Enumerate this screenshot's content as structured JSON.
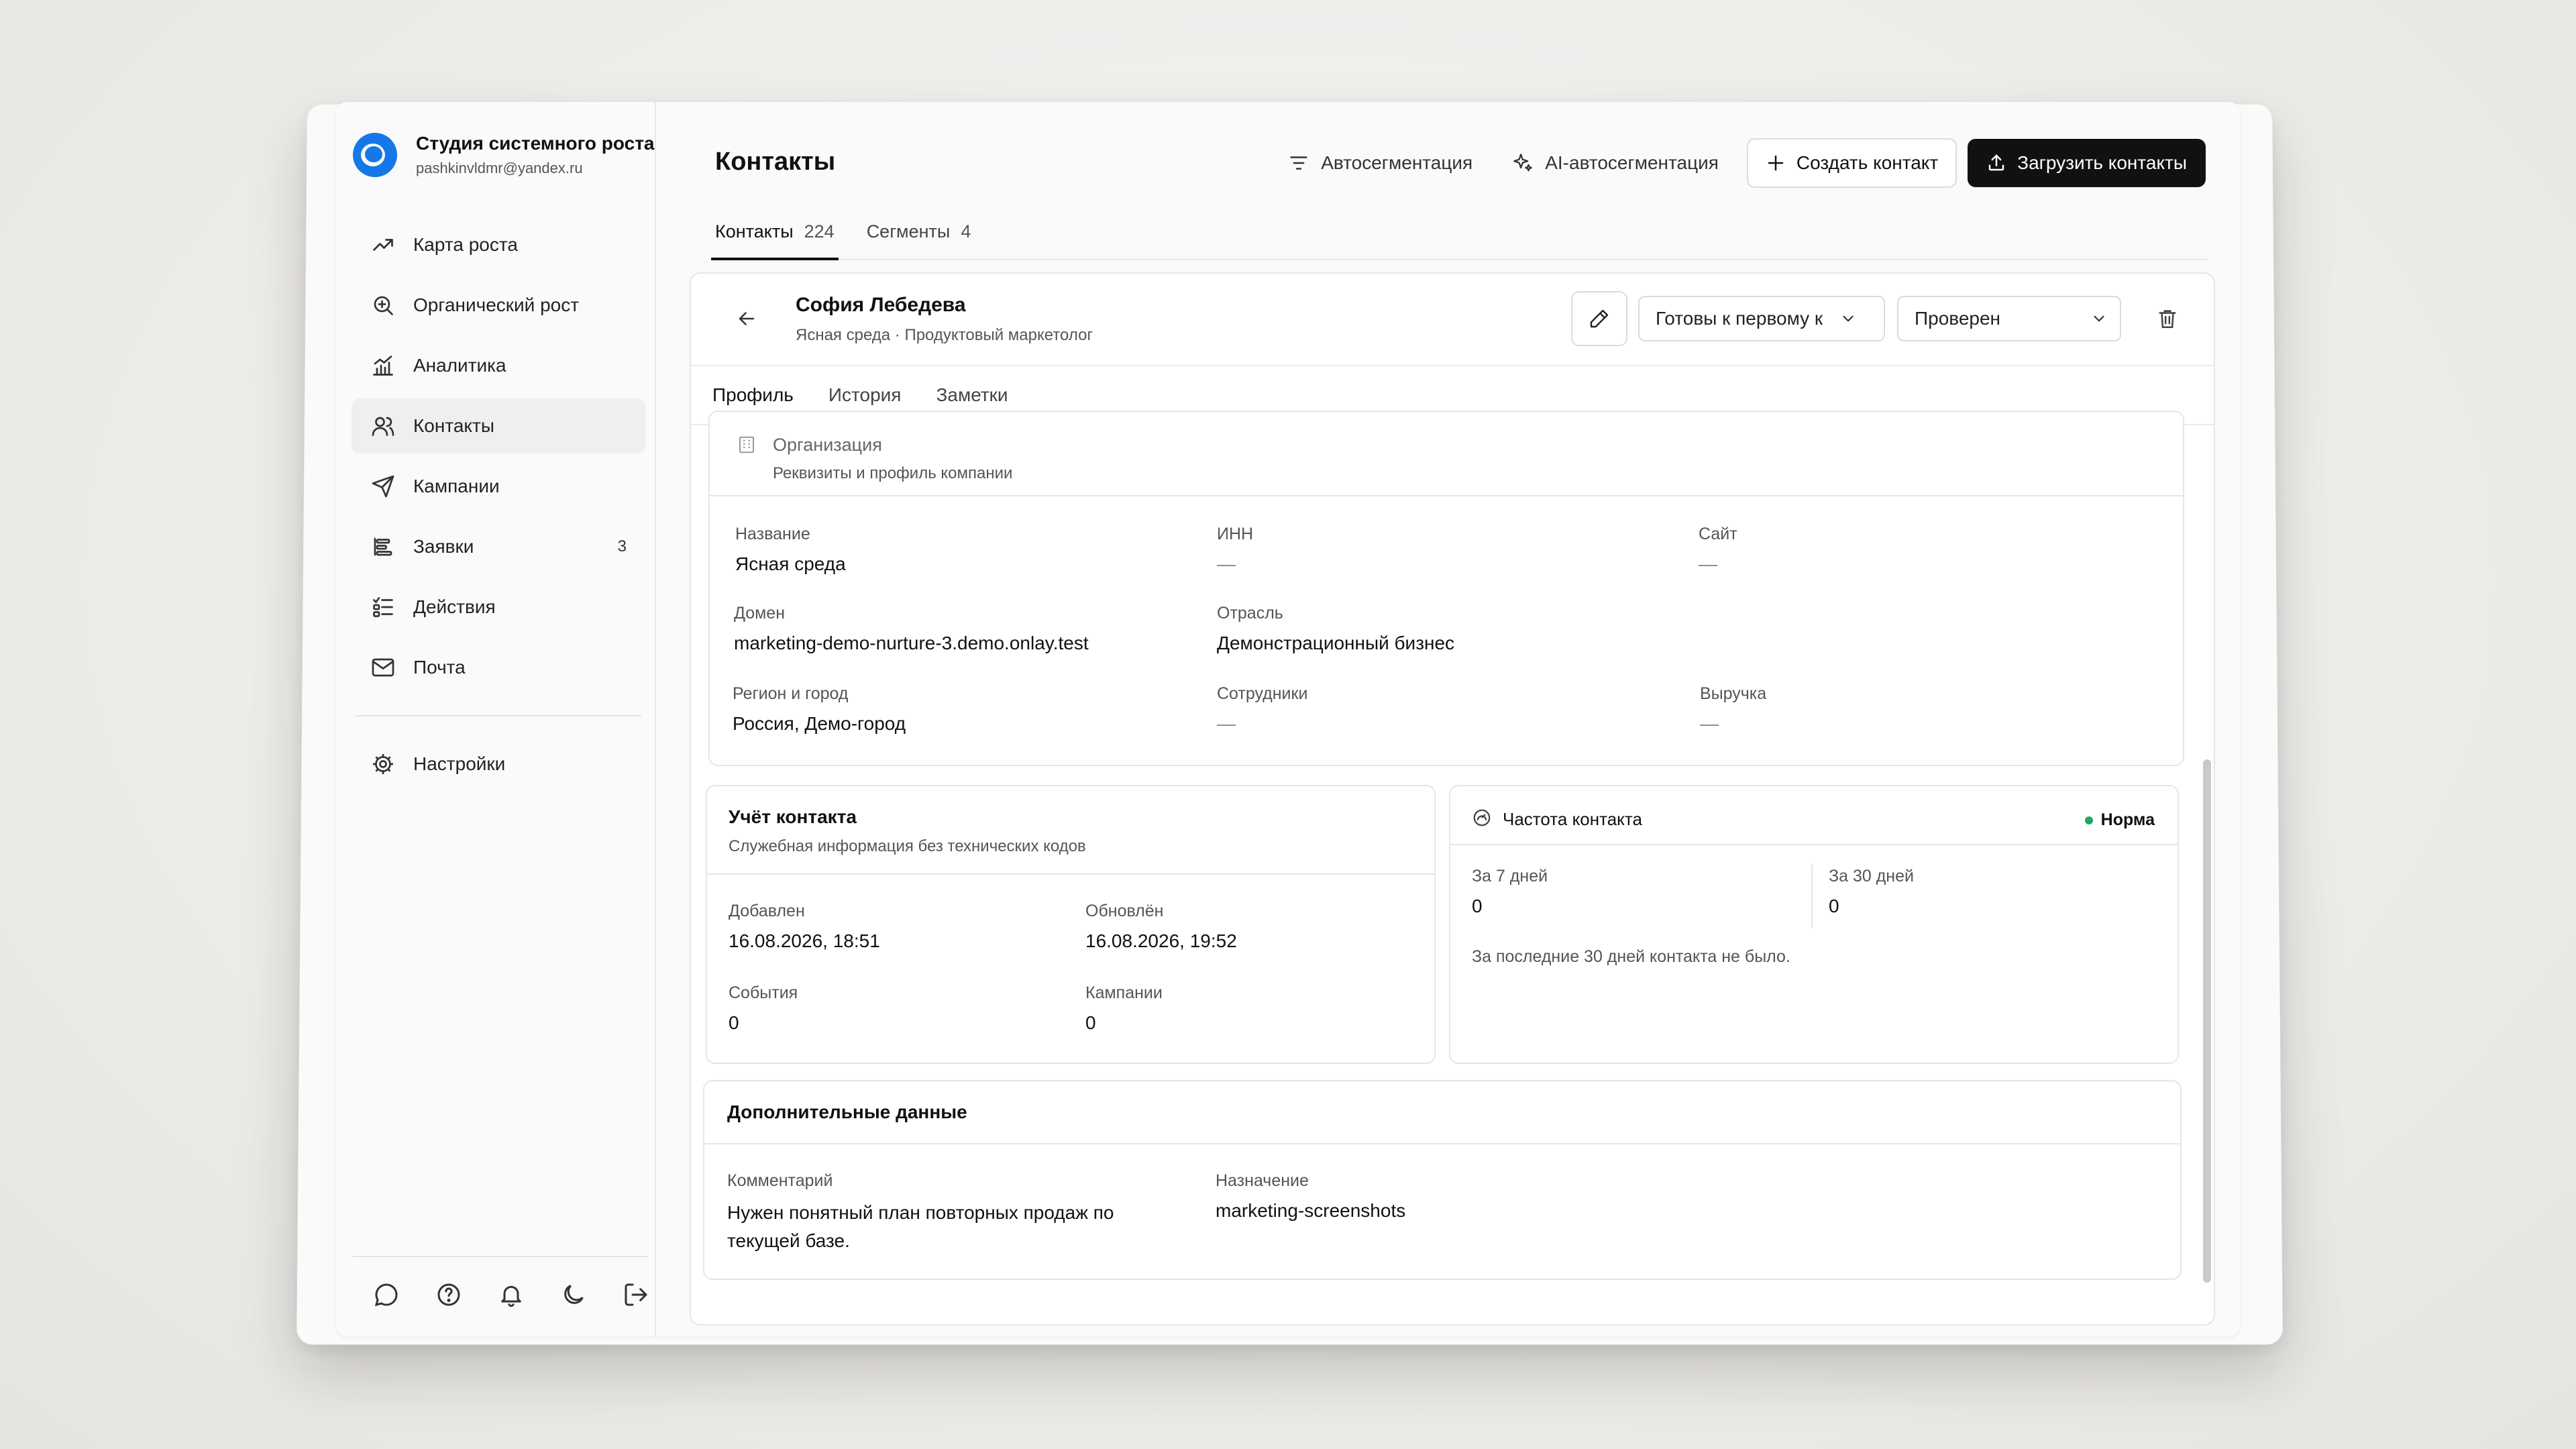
{
  "brand": {
    "name": "Студия системного роста",
    "email": "pashkinvldmr@yandex.ru"
  },
  "nav": {
    "items": [
      {
        "label": "Карта роста",
        "icon": "trend-icon"
      },
      {
        "label": "Органический рост",
        "icon": "search-icon"
      },
      {
        "label": "Аналитика",
        "icon": "chart-icon"
      },
      {
        "label": "Контакты",
        "icon": "users-icon",
        "active": true
      },
      {
        "label": "Кампании",
        "icon": "send-icon"
      },
      {
        "label": "Заявки",
        "icon": "list-icon",
        "badge": "3"
      },
      {
        "label": "Действия",
        "icon": "checklist-icon"
      },
      {
        "label": "Почта",
        "icon": "mail-icon"
      }
    ],
    "settings": "Настройки"
  },
  "header": {
    "title": "Контакты",
    "autoseg": "Автосегментация",
    "ai_autoseg": "AI-автосегментация",
    "create": "Создать контакт",
    "upload": "Загрузить контакты"
  },
  "tabs": [
    {
      "label": "Контакты",
      "count": "224"
    },
    {
      "label": "Сегменты",
      "count": "4"
    }
  ],
  "contact": {
    "name": "София Лебедева",
    "subtitle": "Ясная среда · Продуктовый маркетолог",
    "stage": "Готовы к первому к",
    "status": "Проверен"
  },
  "subtabs": [
    "Профиль",
    "История",
    "Заметки"
  ],
  "org": {
    "title": "Организация",
    "subtitle": "Реквизиты и профиль компании",
    "fields": {
      "name_label": "Название",
      "name_value": "Ясная среда",
      "inn_label": "ИНН",
      "inn_value": "—",
      "site_label": "Сайт",
      "site_value": "—",
      "domain_label": "Домен",
      "domain_value": "marketing-demo-nurture-3.demo.onlay.test",
      "industry_label": "Отрасль",
      "industry_value": "Демонстрационный бизнес",
      "region_label": "Регион и город",
      "region_value": "Россия, Демо-город",
      "staff_label": "Сотрудники",
      "staff_value": "—",
      "revenue_label": "Выручка",
      "revenue_value": "—"
    }
  },
  "account": {
    "title": "Учёт контакта",
    "subtitle": "Служебная информация без технических кодов",
    "added_label": "Добавлен",
    "added_value": "16.08.2026, 18:51",
    "updated_label": "Обновлён",
    "updated_value": "16.08.2026, 19:52",
    "events_label": "События",
    "events_value": "0",
    "campaigns_label": "Кампании",
    "campaigns_value": "0"
  },
  "frequency": {
    "title": "Частота контакта",
    "status": "Норма",
    "status_color": "#1aa862",
    "week_label": "За 7 дней",
    "week_value": "0",
    "month_label": "За 30 дней",
    "month_value": "0",
    "note": "За последние 30 дней контакта не было."
  },
  "extra": {
    "title": "Дополнительные данные",
    "comment_label": "Комментарий",
    "comment_value": "Нужен понятный план повторных продаж по текущей базе.",
    "purpose_label": "Назначение",
    "purpose_value": "marketing-screenshots"
  }
}
